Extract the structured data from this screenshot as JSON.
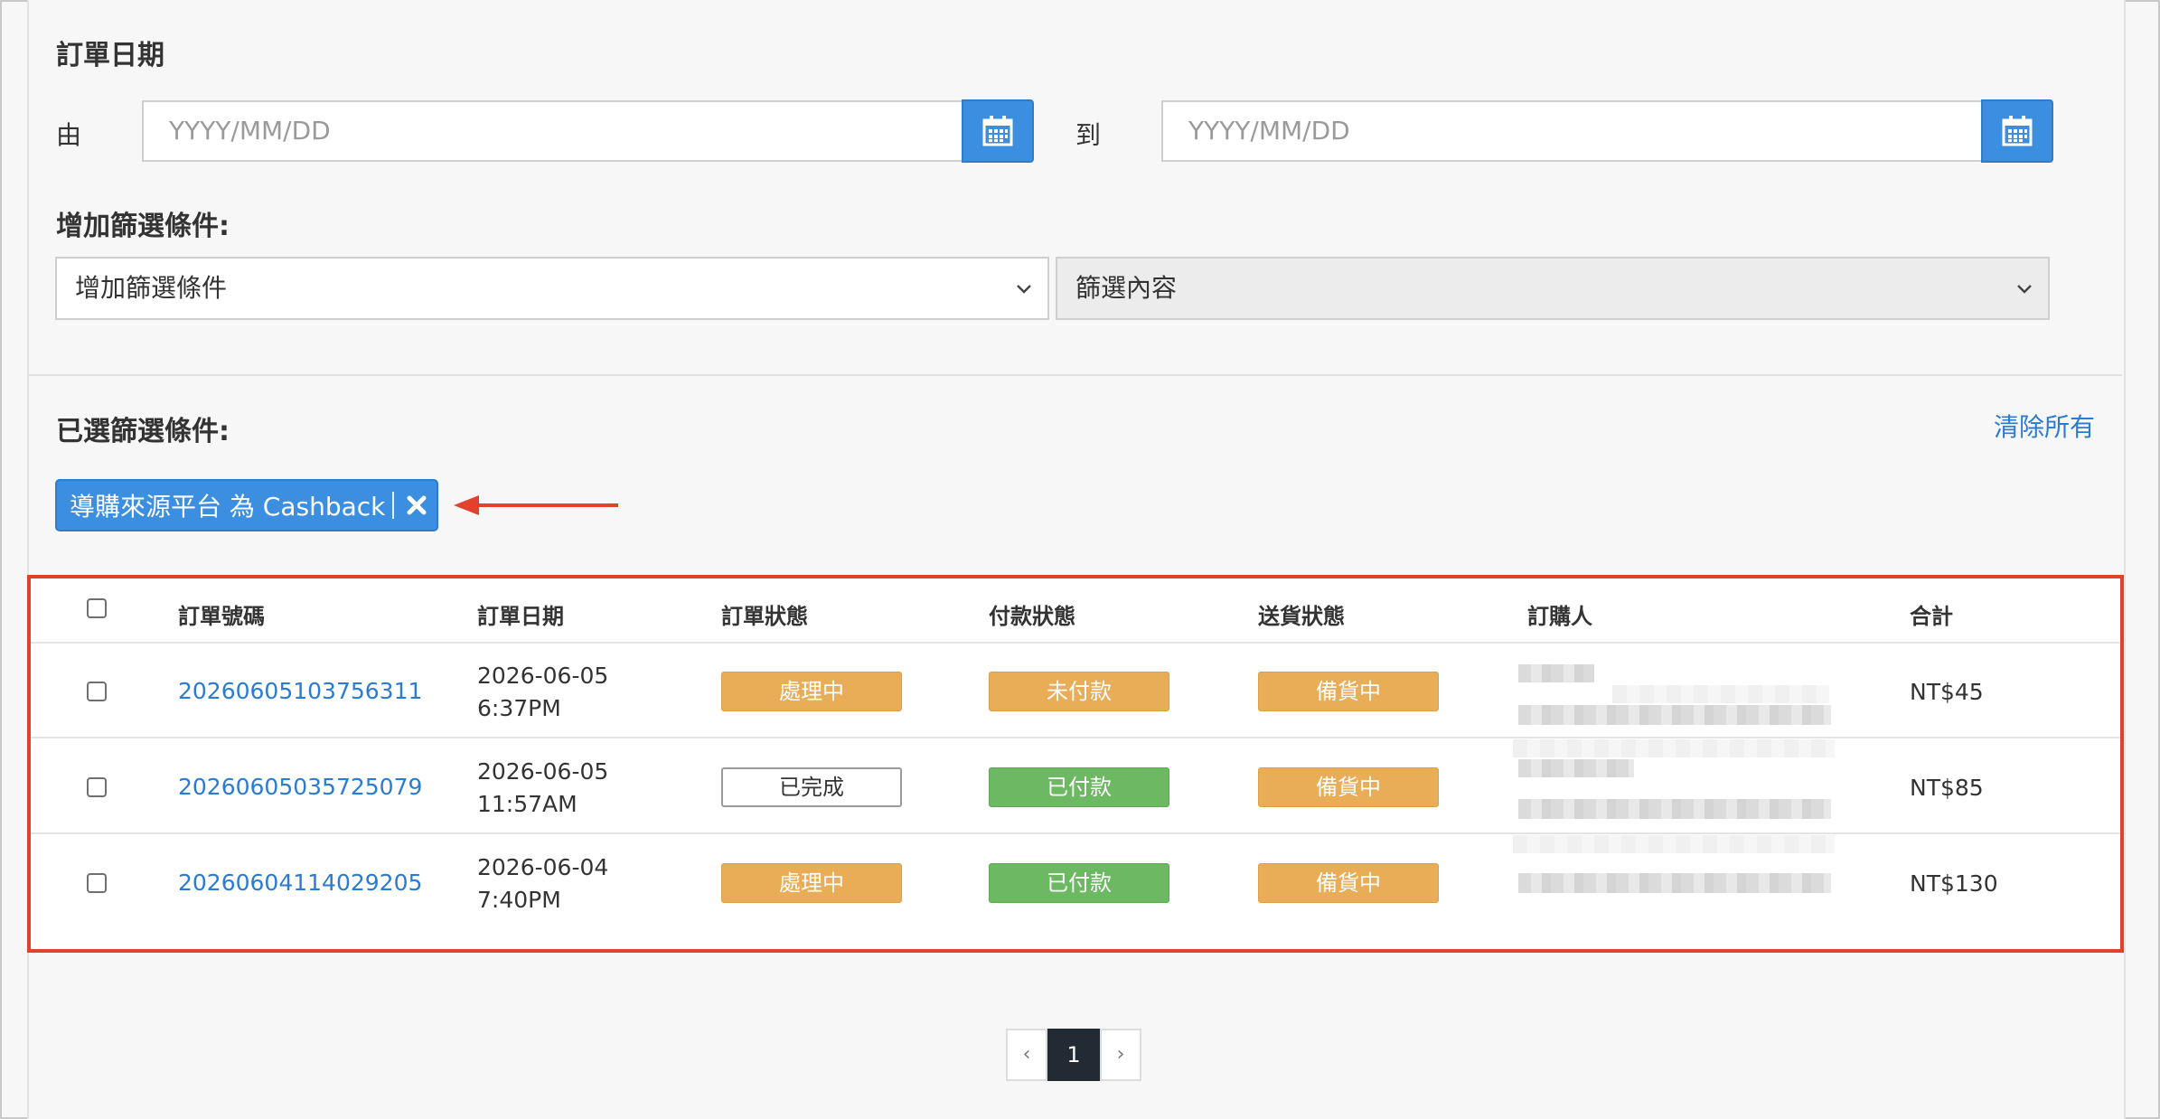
{
  "date_filter": {
    "title": "訂單日期",
    "from_label": "由",
    "to_label": "到",
    "from_placeholder": "YYYY/MM/DD",
    "to_placeholder": "YYYY/MM/DD"
  },
  "add_filter": {
    "title": "增加篩選條件:",
    "field_select_value": "增加篩選條件",
    "content_select_value": "篩選內容"
  },
  "selected_filters": {
    "title": "已選篩選條件:",
    "clear_all": "清除所有",
    "chip_label": "導購來源平台 為 Cashback"
  },
  "table": {
    "headers": {
      "order_no": "訂單號碼",
      "order_date": "訂單日期",
      "order_status": "訂單狀態",
      "payment_status": "付款狀態",
      "delivery_status": "送貨狀態",
      "customer": "訂購人",
      "total": "合計"
    },
    "rows": [
      {
        "order_no": "20260605103756311",
        "date": "2026-06-05",
        "time": "6:37PM",
        "order_status": "處理中",
        "payment_status": "未付款",
        "delivery_status": "備貨中",
        "total": "NT$45"
      },
      {
        "order_no": "20260605035725079",
        "date": "2026-06-05",
        "time": "11:57AM",
        "order_status": "已完成",
        "payment_status": "已付款",
        "delivery_status": "備貨中",
        "total": "NT$85"
      },
      {
        "order_no": "20260604114029205",
        "date": "2026-06-04",
        "time": "7:40PM",
        "order_status": "處理中",
        "payment_status": "已付款",
        "delivery_status": "備貨中",
        "total": "NT$130"
      }
    ]
  },
  "pagination": {
    "prev": "‹",
    "current": "1",
    "next": "›"
  },
  "colors": {
    "accent_blue": "#3b8ee0",
    "link_blue": "#2b7bd1",
    "badge_orange": "#e8ad56",
    "badge_green": "#6db862",
    "highlight_red": "#e2412e"
  },
  "icons": {
    "calendar": "calendar-icon",
    "chevron": "chevron-down-icon",
    "remove": "close-icon",
    "annotation": "arrow-left-icon"
  }
}
